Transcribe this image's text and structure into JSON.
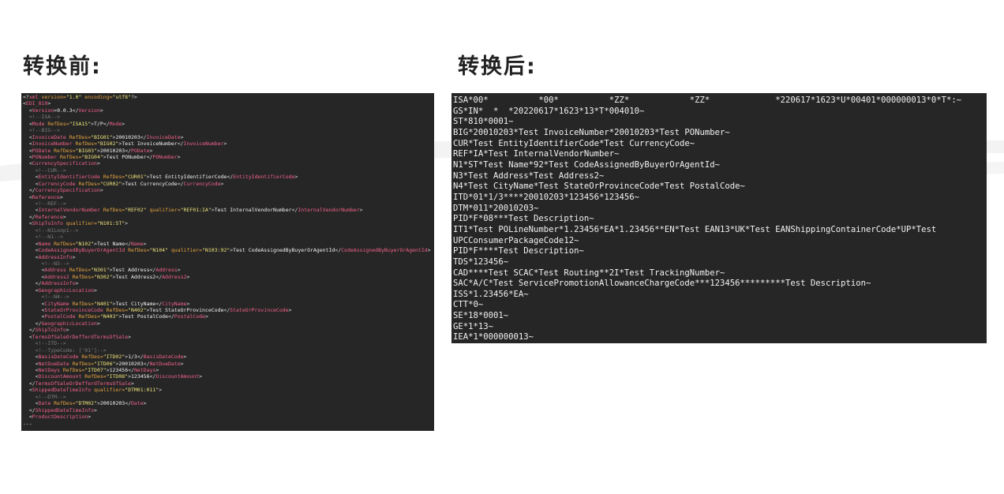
{
  "headings": {
    "left": "转换前:",
    "right": "转换后:"
  },
  "colors": {
    "panel_bg": "#262626",
    "tag": "#f2618a",
    "attribute": "#e6a340",
    "value": "#efe37a",
    "comment": "#7d7d7d",
    "text": "#f0f0f0"
  },
  "xml_lines": [
    [
      [
        "p",
        "<?"
      ],
      [
        "t",
        "xml"
      ],
      [
        "a",
        " version="
      ],
      [
        "v",
        "\"1.0\""
      ],
      [
        "a",
        " encoding="
      ],
      [
        "v",
        "\"utf8\""
      ],
      [
        "p",
        "?>"
      ]
    ],
    [
      [
        "p",
        "<"
      ],
      [
        "t",
        "EDI_810"
      ],
      [
        "p",
        ">"
      ]
    ],
    [
      [
        "p",
        "  <"
      ],
      [
        "t",
        "Version"
      ],
      [
        "p",
        ">"
      ],
      [
        "x",
        "0.0.3"
      ],
      [
        "p",
        "</"
      ],
      [
        "t",
        "Version"
      ],
      [
        "p",
        ">"
      ]
    ],
    [
      [
        "c",
        "  <!--ISA-->"
      ]
    ],
    [
      [
        "p",
        "  <"
      ],
      [
        "t",
        "Mode"
      ],
      [
        "a",
        " RefDes="
      ],
      [
        "v",
        "\"ISA15\""
      ],
      [
        "p",
        ">"
      ],
      [
        "x",
        "T/P"
      ],
      [
        "p",
        "</"
      ],
      [
        "t",
        "Mode"
      ],
      [
        "p",
        ">"
      ]
    ],
    [
      [
        "c",
        "  <!--BIG-->"
      ]
    ],
    [
      [
        "p",
        "  <"
      ],
      [
        "t",
        "InvoiceDate"
      ],
      [
        "a",
        " RefDes="
      ],
      [
        "v",
        "\"BIG01\""
      ],
      [
        "p",
        ">"
      ],
      [
        "x",
        "20010203"
      ],
      [
        "p",
        "</"
      ],
      [
        "t",
        "InvoiceDate"
      ],
      [
        "p",
        ">"
      ]
    ],
    [
      [
        "p",
        "  <"
      ],
      [
        "t",
        "InvoiceNumber"
      ],
      [
        "a",
        " RefDes="
      ],
      [
        "v",
        "\"BIG02\""
      ],
      [
        "p",
        ">"
      ],
      [
        "x",
        "Test InvoiceNumber"
      ],
      [
        "p",
        "</"
      ],
      [
        "t",
        "InvoiceNumber"
      ],
      [
        "p",
        ">"
      ]
    ],
    [
      [
        "p",
        "  <"
      ],
      [
        "t",
        "PODate"
      ],
      [
        "a",
        " RefDes="
      ],
      [
        "v",
        "\"BIG03\""
      ],
      [
        "p",
        ">"
      ],
      [
        "x",
        "20010203"
      ],
      [
        "p",
        "</"
      ],
      [
        "t",
        "PODate"
      ],
      [
        "p",
        ">"
      ]
    ],
    [
      [
        "p",
        "  <"
      ],
      [
        "t",
        "PONumber"
      ],
      [
        "a",
        " RefDes="
      ],
      [
        "v",
        "\"BIG04\""
      ],
      [
        "p",
        ">"
      ],
      [
        "x",
        "Test PONumber"
      ],
      [
        "p",
        "</"
      ],
      [
        "t",
        "PONumber"
      ],
      [
        "p",
        ">"
      ]
    ],
    [
      [
        "p",
        "  <"
      ],
      [
        "t",
        "CurrencySpecification"
      ],
      [
        "p",
        ">"
      ]
    ],
    [
      [
        "c",
        "    <!--CUR-->"
      ]
    ],
    [
      [
        "p",
        "    <"
      ],
      [
        "t",
        "EntityIdentifierCode"
      ],
      [
        "a",
        " RefDes="
      ],
      [
        "v",
        "\"CUR01\""
      ],
      [
        "p",
        ">"
      ],
      [
        "x",
        "Test EntityIdentifierCode"
      ],
      [
        "p",
        "</"
      ],
      [
        "t",
        "EntityIdentifierCode"
      ],
      [
        "p",
        ">"
      ]
    ],
    [
      [
        "p",
        "    <"
      ],
      [
        "t",
        "CurrencyCode"
      ],
      [
        "a",
        " RefDes="
      ],
      [
        "v",
        "\"CUR02\""
      ],
      [
        "p",
        ">"
      ],
      [
        "x",
        "Test CurrencyCode"
      ],
      [
        "p",
        "</"
      ],
      [
        "t",
        "CurrencyCode"
      ],
      [
        "p",
        ">"
      ]
    ],
    [
      [
        "p",
        "  </"
      ],
      [
        "t",
        "CurrencySpecification"
      ],
      [
        "p",
        ">"
      ]
    ],
    [
      [
        "p",
        "  <"
      ],
      [
        "t",
        "Reference"
      ],
      [
        "p",
        ">"
      ]
    ],
    [
      [
        "c",
        "    <!--REF-->"
      ]
    ],
    [
      [
        "p",
        "    <"
      ],
      [
        "t",
        "InternalVendorNumber"
      ],
      [
        "a",
        " RefDes="
      ],
      [
        "v",
        "\"REF02\""
      ],
      [
        "a",
        " qualifier="
      ],
      [
        "v",
        "\"REF01:IA\""
      ],
      [
        "p",
        ">"
      ],
      [
        "x",
        "Test InternalVendorNumber"
      ],
      [
        "p",
        "</"
      ],
      [
        "t",
        "InternalVendorNumber"
      ],
      [
        "p",
        ">"
      ]
    ],
    [
      [
        "p",
        "  </"
      ],
      [
        "t",
        "Reference"
      ],
      [
        "p",
        ">"
      ]
    ],
    [
      [
        "p",
        "  <"
      ],
      [
        "t",
        "ShipToInfo"
      ],
      [
        "a",
        " qualifier="
      ],
      [
        "v",
        "\"N101:ST\""
      ],
      [
        "p",
        ">"
      ]
    ],
    [
      [
        "c",
        "    <!--N1Loop1-->"
      ]
    ],
    [
      [
        "c",
        "    <!--N1-->"
      ]
    ],
    [
      [
        "p",
        "    <"
      ],
      [
        "t",
        "Name"
      ],
      [
        "a",
        " RefDes="
      ],
      [
        "v",
        "\"N102\""
      ],
      [
        "p",
        ">"
      ],
      [
        "x",
        "Test Name"
      ],
      [
        "p",
        "</"
      ],
      [
        "t",
        "Name"
      ],
      [
        "p",
        ">"
      ]
    ],
    [
      [
        "p",
        "    <"
      ],
      [
        "t",
        "CodeAssignedByBuyerOrAgentId"
      ],
      [
        "a",
        " RefDes="
      ],
      [
        "v",
        "\"N104\""
      ],
      [
        "a",
        " qualifier="
      ],
      [
        "v",
        "\"N103:92\""
      ],
      [
        "p",
        ">"
      ],
      [
        "x",
        "Test CodeAssignedByBuyerOrAgentId"
      ],
      [
        "p",
        "</"
      ],
      [
        "t",
        "CodeAssignedByBuyerOrAgentId"
      ],
      [
        "p",
        ">"
      ]
    ],
    [
      [
        "p",
        "    <"
      ],
      [
        "t",
        "AddressInfo"
      ],
      [
        "p",
        ">"
      ]
    ],
    [
      [
        "c",
        "      <!--N3-->"
      ]
    ],
    [
      [
        "p",
        "      <"
      ],
      [
        "t",
        "Address"
      ],
      [
        "a",
        " RefDes="
      ],
      [
        "v",
        "\"N301\""
      ],
      [
        "p",
        ">"
      ],
      [
        "x",
        "Test Address"
      ],
      [
        "p",
        "</"
      ],
      [
        "t",
        "Address"
      ],
      [
        "p",
        ">"
      ]
    ],
    [
      [
        "p",
        "      <"
      ],
      [
        "t",
        "Address2"
      ],
      [
        "a",
        " RefDes="
      ],
      [
        "v",
        "\"N302\""
      ],
      [
        "p",
        ">"
      ],
      [
        "x",
        "Test Address2"
      ],
      [
        "p",
        "</"
      ],
      [
        "t",
        "Address2"
      ],
      [
        "p",
        ">"
      ]
    ],
    [
      [
        "p",
        "    </"
      ],
      [
        "t",
        "AddressInfo"
      ],
      [
        "p",
        ">"
      ]
    ],
    [
      [
        "p",
        "    <"
      ],
      [
        "t",
        "GeographicLocation"
      ],
      [
        "p",
        ">"
      ]
    ],
    [
      [
        "c",
        "      <!--N4-->"
      ]
    ],
    [
      [
        "p",
        "      <"
      ],
      [
        "t",
        "CityName"
      ],
      [
        "a",
        " RefDes="
      ],
      [
        "v",
        "\"N401\""
      ],
      [
        "p",
        ">"
      ],
      [
        "x",
        "Test CityName"
      ],
      [
        "p",
        "</"
      ],
      [
        "t",
        "CityName"
      ],
      [
        "p",
        ">"
      ]
    ],
    [
      [
        "p",
        "      <"
      ],
      [
        "t",
        "StateOrProvinceCode"
      ],
      [
        "a",
        " RefDes="
      ],
      [
        "v",
        "\"N402\""
      ],
      [
        "p",
        ">"
      ],
      [
        "x",
        "Test StateOrProvinceCode"
      ],
      [
        "p",
        "</"
      ],
      [
        "t",
        "StateOrProvinceCode"
      ],
      [
        "p",
        ">"
      ]
    ],
    [
      [
        "p",
        "      <"
      ],
      [
        "t",
        "PostalCode"
      ],
      [
        "a",
        " RefDes="
      ],
      [
        "v",
        "\"N403\""
      ],
      [
        "p",
        ">"
      ],
      [
        "x",
        "Test PostalCode"
      ],
      [
        "p",
        "</"
      ],
      [
        "t",
        "PostalCode"
      ],
      [
        "p",
        ">"
      ]
    ],
    [
      [
        "p",
        "    </"
      ],
      [
        "t",
        "GeographicLocation"
      ],
      [
        "p",
        ">"
      ]
    ],
    [
      [
        "p",
        "  </"
      ],
      [
        "t",
        "ShipToInfo"
      ],
      [
        "p",
        ">"
      ]
    ],
    [
      [
        "p",
        "  <"
      ],
      [
        "t",
        "TermsOfSaleOrDefferdTermsOfSale"
      ],
      [
        "p",
        ">"
      ]
    ],
    [
      [
        "c",
        "    <!--ITD-->"
      ]
    ],
    [
      [
        "c",
        "    <!--TypeCode: ['01']-->"
      ]
    ],
    [
      [
        "p",
        "    <"
      ],
      [
        "t",
        "BasisDateCode"
      ],
      [
        "a",
        " RefDes="
      ],
      [
        "v",
        "\"ITD02\""
      ],
      [
        "p",
        ">"
      ],
      [
        "x",
        "1/3"
      ],
      [
        "p",
        "</"
      ],
      [
        "t",
        "BasisDateCode"
      ],
      [
        "p",
        ">"
      ]
    ],
    [
      [
        "p",
        "    <"
      ],
      [
        "t",
        "NetDueDate"
      ],
      [
        "a",
        " RefDes="
      ],
      [
        "v",
        "\"ITD06\""
      ],
      [
        "p",
        ">"
      ],
      [
        "x",
        "20010203"
      ],
      [
        "p",
        "</"
      ],
      [
        "t",
        "NetDueDate"
      ],
      [
        "p",
        ">"
      ]
    ],
    [
      [
        "p",
        "    <"
      ],
      [
        "t",
        "NetDays"
      ],
      [
        "a",
        " RefDes="
      ],
      [
        "v",
        "\"ITD07\""
      ],
      [
        "p",
        ">"
      ],
      [
        "x",
        "123456"
      ],
      [
        "p",
        "</"
      ],
      [
        "t",
        "NetDays"
      ],
      [
        "p",
        ">"
      ]
    ],
    [
      [
        "p",
        "    <"
      ],
      [
        "t",
        "DiscountAmount"
      ],
      [
        "a",
        " RefDes="
      ],
      [
        "v",
        "\"ITD08\""
      ],
      [
        "p",
        ">"
      ],
      [
        "x",
        "123456"
      ],
      [
        "p",
        "</"
      ],
      [
        "t",
        "DiscountAmount"
      ],
      [
        "p",
        ">"
      ]
    ],
    [
      [
        "p",
        "  </"
      ],
      [
        "t",
        "TermsOfSaleOrDefferdTermsOfSale"
      ],
      [
        "p",
        ">"
      ]
    ],
    [
      [
        "p",
        "  <"
      ],
      [
        "t",
        "ShippedDateTimeInfo"
      ],
      [
        "a",
        " qualifier="
      ],
      [
        "v",
        "\"DTM01:011\""
      ],
      [
        "p",
        ">"
      ]
    ],
    [
      [
        "c",
        "    <!--DTM-->"
      ]
    ],
    [
      [
        "p",
        "    <"
      ],
      [
        "t",
        "Date"
      ],
      [
        "a",
        " RefDes="
      ],
      [
        "v",
        "\"DTM02\""
      ],
      [
        "p",
        ">"
      ],
      [
        "x",
        "20010203"
      ],
      [
        "p",
        "</"
      ],
      [
        "t",
        "Date"
      ],
      [
        "p",
        ">"
      ]
    ],
    [
      [
        "p",
        "  </"
      ],
      [
        "t",
        "ShippedDateTimeInfo"
      ],
      [
        "p",
        ">"
      ]
    ],
    [
      [
        "p",
        "  <"
      ],
      [
        "t",
        "ProductDescription"
      ],
      [
        "p",
        ">"
      ]
    ],
    [
      [
        "x",
        "..."
      ]
    ]
  ],
  "edi_lines": [
    "ISA*00*          *00*          *ZZ*            *ZZ*             *220617*1623*U*00401*000000013*0*T*:~",
    "GS*IN*  *  *20220617*1623*13*T*004010~",
    "ST*810*0001~",
    "BIG*20010203*Test InvoiceNumber*20010203*Test PONumber~",
    "CUR*Test EntityIdentifierCode*Test CurrencyCode~",
    "REF*IA*Test InternalVendorNumber~",
    "N1*ST*Test Name*92*Test CodeAssignedByBuyerOrAgentId~",
    "N3*Test Address*Test Address2~",
    "N4*Test CityName*Test StateOrProvinceCode*Test PostalCode~",
    "ITD*01*1/3****20010203*123456*123456~",
    "DTM*011*20010203~",
    "PID*F*08***Test Description~",
    "IT1*Test POLineNumber*1.23456*EA*1.23456**EN*Test EAN13*UK*Test EANShippingContainerCode*UP*Test",
    "UPCConsumerPackageCode12~",
    "PID*F****Test Description~",
    "TDS*123456~",
    "CAD****Test SCAC*Test Routing**2I*Test TrackingNumber~",
    "SAC*A/C*Test ServicePromotionAllowanceChargeCode***123456*********Test Description~",
    "ISS*1.23456*EA~",
    "CTT*0~",
    "SE*18*0001~",
    "GE*1*13~",
    "IEA*1*000000013~"
  ]
}
